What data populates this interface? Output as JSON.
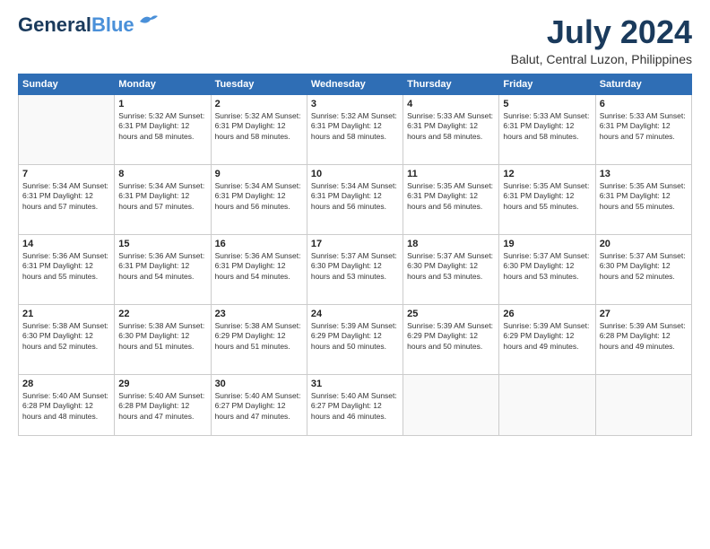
{
  "logo": {
    "line1": "General",
    "line2": "Blue"
  },
  "title": {
    "month_year": "July 2024",
    "location": "Balut, Central Luzon, Philippines"
  },
  "weekdays": [
    "Sunday",
    "Monday",
    "Tuesday",
    "Wednesday",
    "Thursday",
    "Friday",
    "Saturday"
  ],
  "weeks": [
    [
      {
        "day": "",
        "info": ""
      },
      {
        "day": "1",
        "info": "Sunrise: 5:32 AM\nSunset: 6:31 PM\nDaylight: 12 hours\nand 58 minutes."
      },
      {
        "day": "2",
        "info": "Sunrise: 5:32 AM\nSunset: 6:31 PM\nDaylight: 12 hours\nand 58 minutes."
      },
      {
        "day": "3",
        "info": "Sunrise: 5:32 AM\nSunset: 6:31 PM\nDaylight: 12 hours\nand 58 minutes."
      },
      {
        "day": "4",
        "info": "Sunrise: 5:33 AM\nSunset: 6:31 PM\nDaylight: 12 hours\nand 58 minutes."
      },
      {
        "day": "5",
        "info": "Sunrise: 5:33 AM\nSunset: 6:31 PM\nDaylight: 12 hours\nand 58 minutes."
      },
      {
        "day": "6",
        "info": "Sunrise: 5:33 AM\nSunset: 6:31 PM\nDaylight: 12 hours\nand 57 minutes."
      }
    ],
    [
      {
        "day": "7",
        "info": "Sunrise: 5:34 AM\nSunset: 6:31 PM\nDaylight: 12 hours\nand 57 minutes."
      },
      {
        "day": "8",
        "info": "Sunrise: 5:34 AM\nSunset: 6:31 PM\nDaylight: 12 hours\nand 57 minutes."
      },
      {
        "day": "9",
        "info": "Sunrise: 5:34 AM\nSunset: 6:31 PM\nDaylight: 12 hours\nand 56 minutes."
      },
      {
        "day": "10",
        "info": "Sunrise: 5:34 AM\nSunset: 6:31 PM\nDaylight: 12 hours\nand 56 minutes."
      },
      {
        "day": "11",
        "info": "Sunrise: 5:35 AM\nSunset: 6:31 PM\nDaylight: 12 hours\nand 56 minutes."
      },
      {
        "day": "12",
        "info": "Sunrise: 5:35 AM\nSunset: 6:31 PM\nDaylight: 12 hours\nand 55 minutes."
      },
      {
        "day": "13",
        "info": "Sunrise: 5:35 AM\nSunset: 6:31 PM\nDaylight: 12 hours\nand 55 minutes."
      }
    ],
    [
      {
        "day": "14",
        "info": "Sunrise: 5:36 AM\nSunset: 6:31 PM\nDaylight: 12 hours\nand 55 minutes."
      },
      {
        "day": "15",
        "info": "Sunrise: 5:36 AM\nSunset: 6:31 PM\nDaylight: 12 hours\nand 54 minutes."
      },
      {
        "day": "16",
        "info": "Sunrise: 5:36 AM\nSunset: 6:31 PM\nDaylight: 12 hours\nand 54 minutes."
      },
      {
        "day": "17",
        "info": "Sunrise: 5:37 AM\nSunset: 6:30 PM\nDaylight: 12 hours\nand 53 minutes."
      },
      {
        "day": "18",
        "info": "Sunrise: 5:37 AM\nSunset: 6:30 PM\nDaylight: 12 hours\nand 53 minutes."
      },
      {
        "day": "19",
        "info": "Sunrise: 5:37 AM\nSunset: 6:30 PM\nDaylight: 12 hours\nand 53 minutes."
      },
      {
        "day": "20",
        "info": "Sunrise: 5:37 AM\nSunset: 6:30 PM\nDaylight: 12 hours\nand 52 minutes."
      }
    ],
    [
      {
        "day": "21",
        "info": "Sunrise: 5:38 AM\nSunset: 6:30 PM\nDaylight: 12 hours\nand 52 minutes."
      },
      {
        "day": "22",
        "info": "Sunrise: 5:38 AM\nSunset: 6:30 PM\nDaylight: 12 hours\nand 51 minutes."
      },
      {
        "day": "23",
        "info": "Sunrise: 5:38 AM\nSunset: 6:29 PM\nDaylight: 12 hours\nand 51 minutes."
      },
      {
        "day": "24",
        "info": "Sunrise: 5:39 AM\nSunset: 6:29 PM\nDaylight: 12 hours\nand 50 minutes."
      },
      {
        "day": "25",
        "info": "Sunrise: 5:39 AM\nSunset: 6:29 PM\nDaylight: 12 hours\nand 50 minutes."
      },
      {
        "day": "26",
        "info": "Sunrise: 5:39 AM\nSunset: 6:29 PM\nDaylight: 12 hours\nand 49 minutes."
      },
      {
        "day": "27",
        "info": "Sunrise: 5:39 AM\nSunset: 6:28 PM\nDaylight: 12 hours\nand 49 minutes."
      }
    ],
    [
      {
        "day": "28",
        "info": "Sunrise: 5:40 AM\nSunset: 6:28 PM\nDaylight: 12 hours\nand 48 minutes."
      },
      {
        "day": "29",
        "info": "Sunrise: 5:40 AM\nSunset: 6:28 PM\nDaylight: 12 hours\nand 47 minutes."
      },
      {
        "day": "30",
        "info": "Sunrise: 5:40 AM\nSunset: 6:27 PM\nDaylight: 12 hours\nand 47 minutes."
      },
      {
        "day": "31",
        "info": "Sunrise: 5:40 AM\nSunset: 6:27 PM\nDaylight: 12 hours\nand 46 minutes."
      },
      {
        "day": "",
        "info": ""
      },
      {
        "day": "",
        "info": ""
      },
      {
        "day": "",
        "info": ""
      }
    ]
  ]
}
